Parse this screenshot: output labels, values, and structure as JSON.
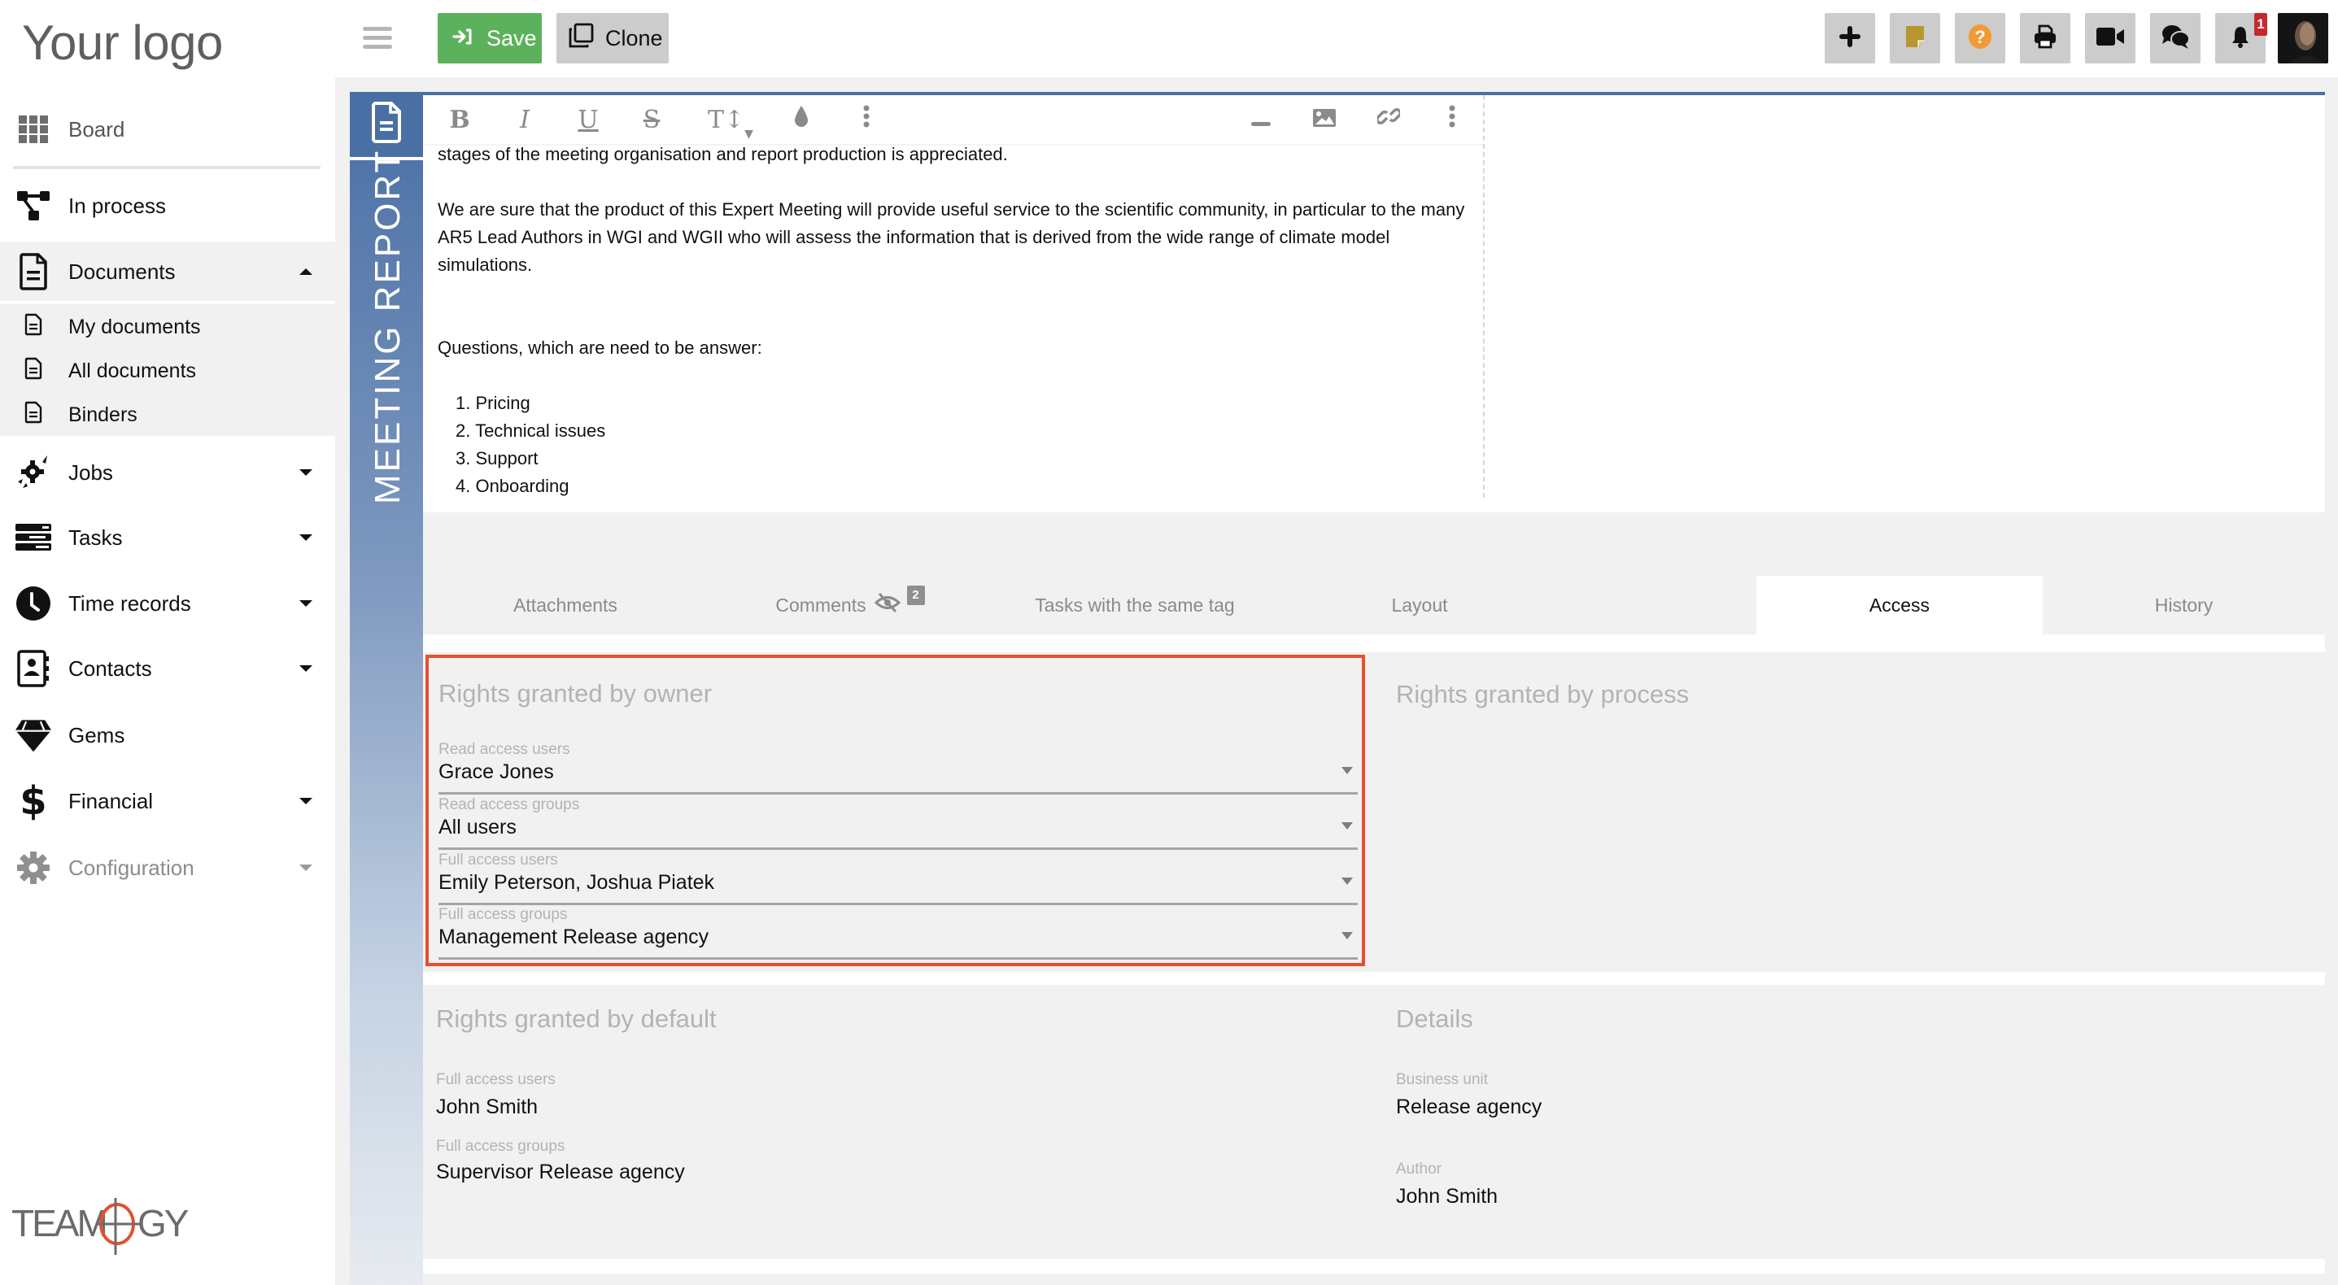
{
  "sidebar": {
    "logo": "Your logo",
    "items": [
      {
        "label": "Board",
        "icon": "grid-icon"
      },
      {
        "label": "In process",
        "icon": "process-icon"
      },
      {
        "label": "Documents",
        "icon": "document-icon",
        "expanded": true
      },
      {
        "label": "Jobs",
        "icon": "jobs-icon"
      },
      {
        "label": "Tasks",
        "icon": "tasks-icon"
      },
      {
        "label": "Time records",
        "icon": "clock-icon"
      },
      {
        "label": "Contacts",
        "icon": "contacts-icon"
      },
      {
        "label": "Gems",
        "icon": "gem-icon"
      },
      {
        "label": "Financial",
        "icon": "dollar-icon"
      },
      {
        "label": "Configuration",
        "icon": "gear-icon"
      }
    ],
    "documents_sub": [
      {
        "label": "My documents"
      },
      {
        "label": "All documents"
      },
      {
        "label": "Binders"
      }
    ],
    "brand": "TEAMOGY"
  },
  "toolbar": {
    "save_label": "Save",
    "clone_label": "Clone",
    "notification_count": "1",
    "colors": {
      "save": "#5cb25c",
      "sticky_note": "#b8962f",
      "help": "#f39a36",
      "notification_badge": "#c6282b"
    }
  },
  "document": {
    "type_title": "MEETING REPORT",
    "accent_color": "#4a6fa5",
    "editor_tools": [
      "bold",
      "italic",
      "underline",
      "strikethrough",
      "text-size",
      "color",
      "more",
      "horizontal-rule",
      "image",
      "link",
      "more"
    ],
    "body": {
      "p1": "stages of the meeting organisation and report production is appreciated.",
      "p2": "We are sure that the product of this Expert Meeting will provide useful service to the scientific community, in particular to the many AR5 Lead Authors in WGI and WGII who will assess the information that is derived from the wide range of climate model simulations.",
      "p3": "Questions, which are need to be answer:",
      "list": [
        "1. Pricing",
        "2. Technical issues",
        "3. Support",
        "4. Onboarding"
      ]
    }
  },
  "tabs": [
    {
      "label": "Attachments"
    },
    {
      "label": "Comments",
      "badge": "2"
    },
    {
      "label": "Tasks with the same tag"
    },
    {
      "label": "Layout"
    },
    {
      "label": "Access",
      "active": true
    },
    {
      "label": "History"
    }
  ],
  "access": {
    "owner": {
      "title": "Rights granted by owner",
      "fields": [
        {
          "label": "Read access users",
          "value": "Grace Jones"
        },
        {
          "label": "Read access groups",
          "value": "All users"
        },
        {
          "label": "Full access users",
          "value": "Emily Peterson, Joshua Piatek"
        },
        {
          "label": "Full access groups",
          "value": "Management Release agency"
        }
      ]
    },
    "process": {
      "title": "Rights granted by process"
    },
    "defaults": {
      "title": "Rights granted by default",
      "fields": [
        {
          "label": "Full access users",
          "value": "John Smith"
        },
        {
          "label": "Full access groups",
          "value": "Supervisor Release agency"
        }
      ]
    },
    "details": {
      "title": "Details",
      "fields": [
        {
          "label": "Business unit",
          "value": "Release agency"
        },
        {
          "label": "Author",
          "value": "John Smith"
        }
      ]
    }
  }
}
